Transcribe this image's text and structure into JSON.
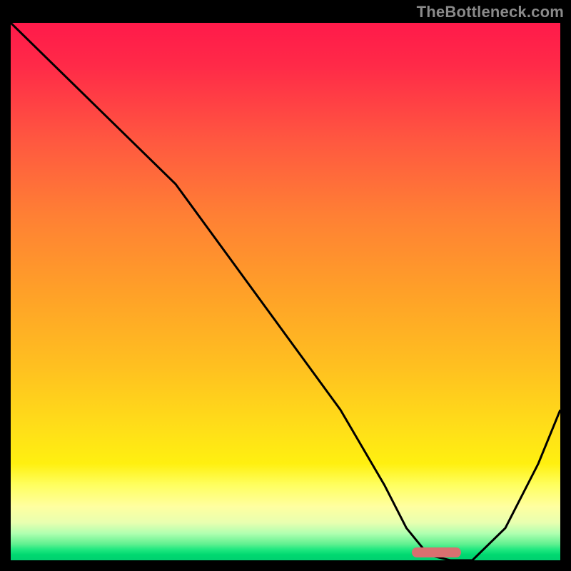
{
  "watermark": "TheBottleneck.com",
  "chart_data": {
    "type": "line",
    "title": "",
    "xlabel": "",
    "ylabel": "",
    "xlim": [
      0,
      100
    ],
    "ylim": [
      0,
      100
    ],
    "grid": false,
    "legend": false,
    "background": "red-yellow-green vertical gradient",
    "series": [
      {
        "name": "curve",
        "x": [
          0,
          10,
          22,
          30,
          40,
          50,
          60,
          68,
          72,
          76,
          80,
          84,
          90,
          96,
          100
        ],
        "y": [
          100,
          90,
          78,
          70,
          56,
          42,
          28,
          14,
          6,
          1,
          0,
          0,
          6,
          18,
          28
        ]
      }
    ],
    "marker": {
      "x_start": 73,
      "x_end": 82,
      "y": 1.5,
      "color": "#d87070"
    }
  }
}
